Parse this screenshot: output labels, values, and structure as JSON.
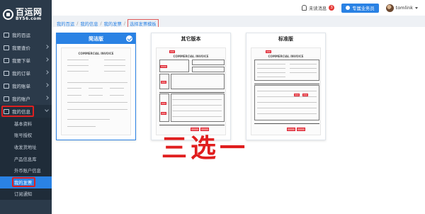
{
  "logo": {
    "main": "百运网",
    "sub": "BY56.com"
  },
  "sidebar": {
    "items": [
      {
        "label": "我的百运"
      },
      {
        "label": "我要查价"
      },
      {
        "label": "我要下单"
      },
      {
        "label": "我的订单"
      },
      {
        "label": "我的账单"
      },
      {
        "label": "我的账户"
      },
      {
        "label": "我的信息"
      }
    ],
    "sub_items": [
      {
        "label": "基本资料"
      },
      {
        "label": "账号授权"
      },
      {
        "label": "收发货地址"
      },
      {
        "label": "产品信息库"
      },
      {
        "label": "外币账户信息"
      },
      {
        "label": "我的发票"
      },
      {
        "label": "订阅通知"
      }
    ]
  },
  "topbar": {
    "notice_label": "未读消息",
    "notice_count": "3",
    "service_button": "专属业务员",
    "username": "tomlink"
  },
  "breadcrumb": [
    "我的百运",
    "我的信息",
    "我的发票",
    "选择发票模板"
  ],
  "templates": [
    {
      "title": "简洁版",
      "selected": true,
      "doc_heading": "COMMERCIAL INVOICE"
    },
    {
      "title": "其它版本",
      "selected": false,
      "doc_heading": "COMMERCIAL INVOICE"
    },
    {
      "title": "标准版",
      "selected": false,
      "doc_heading": "COMMERCIAL INVOICE"
    }
  ],
  "annotation": "三选一",
  "colors": {
    "sidebar_bg": "#2b3a4a",
    "accent": "#2a82e4",
    "highlight_red": "#e02020"
  }
}
